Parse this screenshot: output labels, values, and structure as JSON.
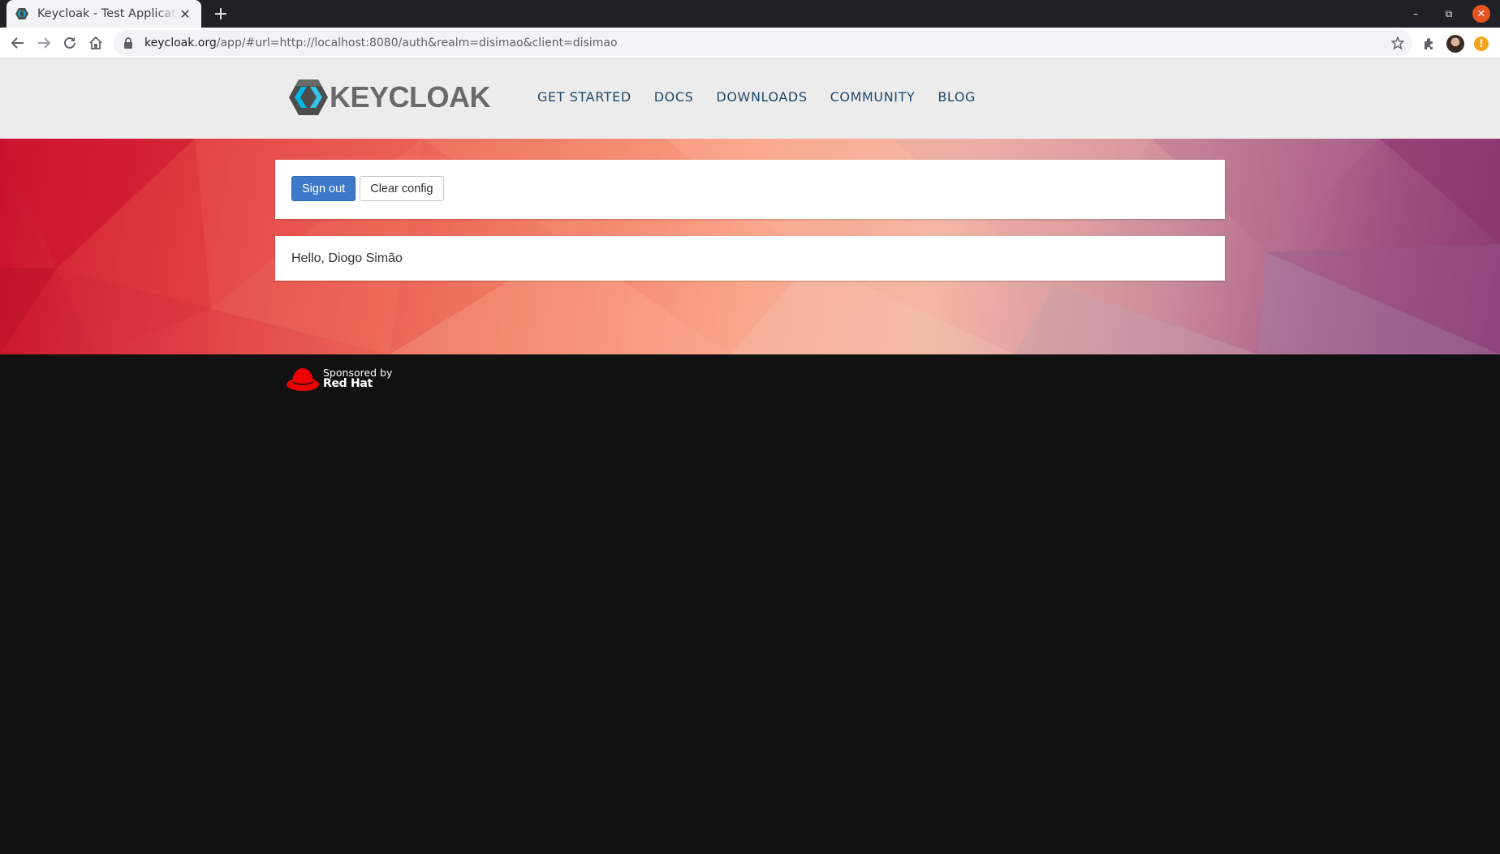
{
  "browser": {
    "tab": {
      "title": "Keycloak - Test Application",
      "favicon": "keycloak-favicon-icon"
    },
    "url": {
      "host": "keycloak.org",
      "path": "/app/#url=http://localhost:8080/auth&realm=disimao&client=disimao"
    },
    "window_controls": {
      "minimize": "–",
      "restore": "⧉",
      "close": "✕"
    },
    "new_tab": "+",
    "tab_close": "✕",
    "update_badge": "!"
  },
  "header": {
    "logo_text": "KEYCLOAK",
    "nav": [
      {
        "label": "GET STARTED"
      },
      {
        "label": "DOCS"
      },
      {
        "label": "DOWNLOADS"
      },
      {
        "label": "COMMUNITY"
      },
      {
        "label": "BLOG"
      }
    ]
  },
  "actions": {
    "sign_out": "Sign out",
    "clear_config": "Clear config"
  },
  "greeting": "Hello, Diogo Simão",
  "footer": {
    "sponsored_by": "Sponsored by",
    "sponsor_name": "Red Hat"
  },
  "colors": {
    "nav_link": "#1e4870",
    "primary_button": "#3d78c9",
    "footer_bg": "#111111",
    "header_bg": "#ececec",
    "redhat_red": "#ee0000"
  }
}
